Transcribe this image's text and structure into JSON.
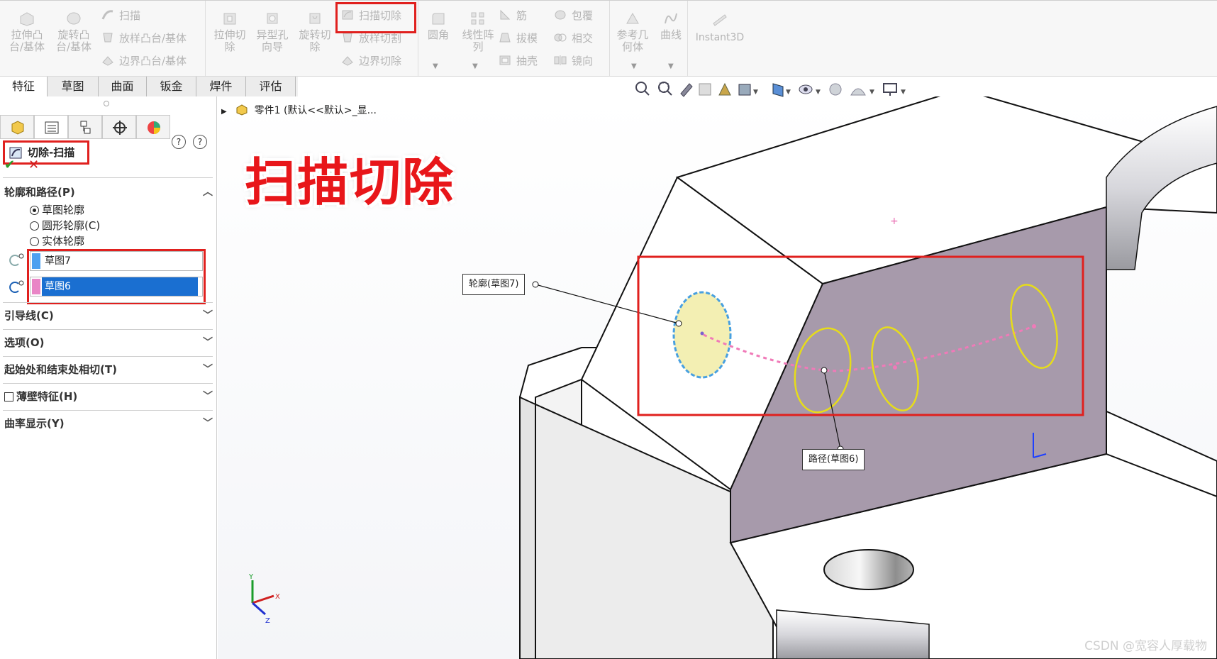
{
  "ribbon": {
    "group_extrude": {
      "extrude_boss": "拉伸凸\n台/基体",
      "revolve_boss": "旋转凸\n台/基体",
      "sweep": "扫描",
      "loft_boss": "放样凸台/基体",
      "boundary_boss": "边界凸台/基体"
    },
    "group_cut": {
      "extrude_cut": "拉伸切\n除",
      "hole_wizard": "异型孔\n向导",
      "revolve_cut": "旋转切\n除",
      "swept_cut": "扫描切除",
      "lofted_cut": "放样切割",
      "boundary_cut": "边界切除"
    },
    "group_features": {
      "fillet": "圆角",
      "linear_pattern": "线性阵\n列",
      "rib": "筋",
      "draft": "拔模",
      "shell": "抽壳",
      "wrap": "包覆",
      "intersect": "相交",
      "mirror": "镜向"
    },
    "group_ref": {
      "reference_geometry": "参考几\n何体",
      "curves": "曲线"
    },
    "instant3d": "Instant3D"
  },
  "tabs": [
    "特征",
    "草图",
    "曲面",
    "钣金",
    "焊件",
    "评估"
  ],
  "active_tab_index": 0,
  "property_manager": {
    "title": "切除-扫描",
    "sections": {
      "profile_path": "轮廓和路径(P)",
      "guide_curves": "引导线(C)",
      "options": "选项(O)",
      "tangency": "起始处和结束处相切(T)",
      "thin_feature": "薄壁特征(H)",
      "curvature_display": "曲率显示(Y)"
    },
    "radio_options": [
      {
        "label": "草图轮廓",
        "selected": true
      },
      {
        "label": "圆形轮廓(C)",
        "selected": false
      },
      {
        "label": "实体轮廓",
        "selected": false
      }
    ],
    "profile_field": "草图7",
    "path_field": "草图6",
    "ok": "✔",
    "cancel": "✕"
  },
  "viewport": {
    "breadcrumb": "零件1  (默认<<默认>_显...",
    "big_label": "扫描切除",
    "callout_profile": "轮廓(草图7)",
    "callout_path": "路径(草图6)",
    "watermark": "CSDN @宽容人厚载物"
  },
  "colors": {
    "highlight_red": "#e0201e",
    "label_red": "#e8161a",
    "purple_face": "#a79aab",
    "profile_fill": "#f3efb3",
    "ellipse_yellow": "#e6dc1a",
    "path_pink": "#f07ab8",
    "field_blue": "#4da0f0",
    "field_pink": "#e986c6",
    "selection_blue": "#1a6fd1"
  }
}
